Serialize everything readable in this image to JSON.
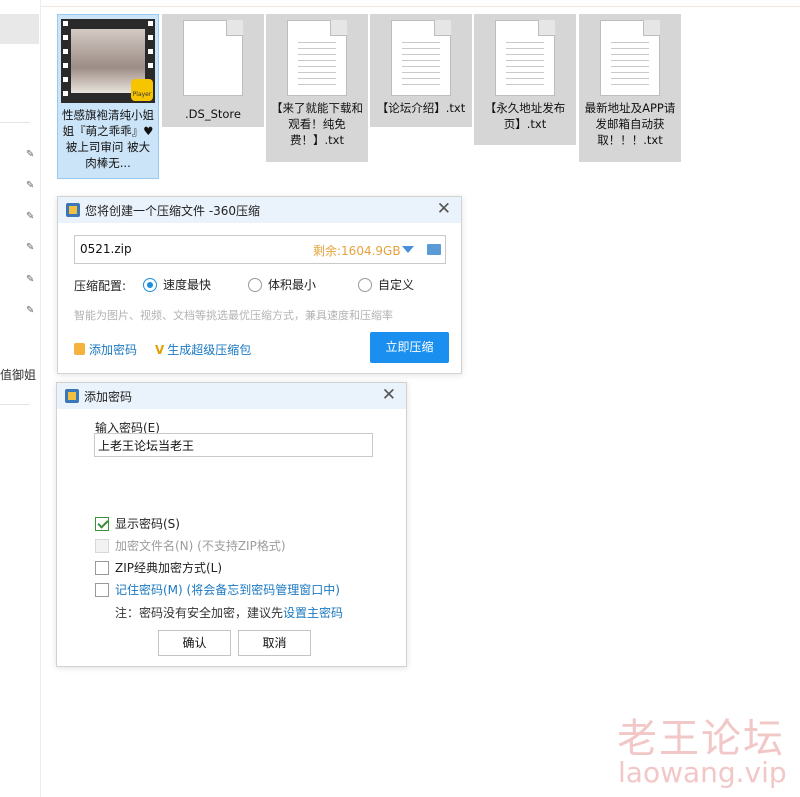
{
  "left_pane": {
    "truncated_text": "值御姐"
  },
  "files": [
    {
      "name": "性感旗袍清纯小姐姐『萌之乖乖』♥被上司审问 被大肉棒无...",
      "type": "video",
      "badge": "Player"
    },
    {
      "name": ".DS_Store",
      "type": "file"
    },
    {
      "name": "【来了就能下载和观看！纯免费！】.txt",
      "type": "txt"
    },
    {
      "name": "【论坛介绍】.txt",
      "type": "txt"
    },
    {
      "name": "【永久地址发布页】.txt",
      "type": "txt"
    },
    {
      "name": "最新地址及APP请发邮箱自动获取！！！.txt",
      "type": "txt"
    }
  ],
  "compress_dialog": {
    "title": "您将创建一个压缩文件 -360压缩",
    "filename": "0521.zip",
    "remaining": "剩余:1604.9GB",
    "config_label": "压缩配置:",
    "options": [
      {
        "label": "速度最快",
        "selected": true
      },
      {
        "label": "体积最小",
        "selected": false
      },
      {
        "label": "自定义",
        "selected": false
      }
    ],
    "hint": "智能为图片、视频、文档等挑选最优压缩方式，兼具速度和压缩率",
    "add_password": "添加密码",
    "super_compress": "生成超级压缩包",
    "compress_now": "立即压缩"
  },
  "password_dialog": {
    "title": "添加密码",
    "input_label": "输入密码(E)",
    "password_value": "上老王论坛当老王",
    "checkboxes": [
      {
        "label": "显示密码(S)",
        "checked": true,
        "disabled": false
      },
      {
        "label": "加密文件名(N) (不支持ZIP格式)",
        "checked": false,
        "disabled": true
      },
      {
        "label": "ZIP经典加密方式(L)",
        "checked": false,
        "disabled": false
      },
      {
        "label": "记住密码(M) (将会备忘到密码管理窗口中)",
        "checked": false,
        "disabled": false
      }
    ],
    "note_prefix": "注：密码没有安全加密，建议先",
    "note_link": "设置主密码",
    "ok": "确认",
    "cancel": "取消"
  },
  "watermark": {
    "title": "老王论坛",
    "domain": "laowang.vip"
  },
  "colors": {
    "accent": "#1a8ff0",
    "link": "#1a78c2",
    "selection": "#cce4f7",
    "remaining": "#e6a23c"
  }
}
